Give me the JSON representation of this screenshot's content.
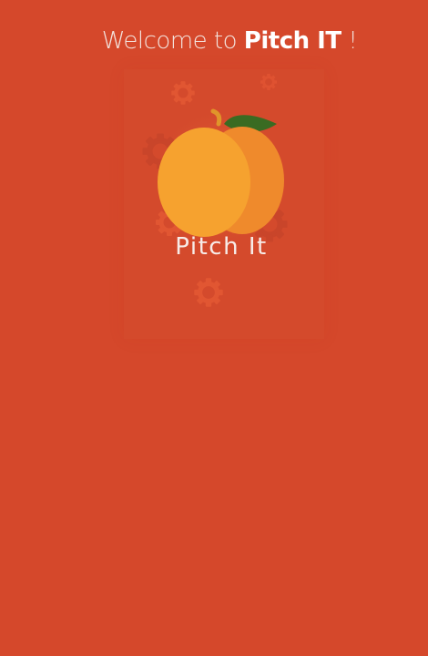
{
  "header": {
    "welcome_prefix": "Welcome to ",
    "brand": "Pitch IT",
    "suffix": " !"
  },
  "splash": {
    "app_name": "Pitch It",
    "logo_icon": "peach-icon",
    "decor_icon": "gear-icon"
  },
  "colors": {
    "background": "#d5482b",
    "peach_front": "#f6a22f",
    "peach_back": "#ef8a2c",
    "leaf": "#3a6b22",
    "gear": "#e15632"
  }
}
